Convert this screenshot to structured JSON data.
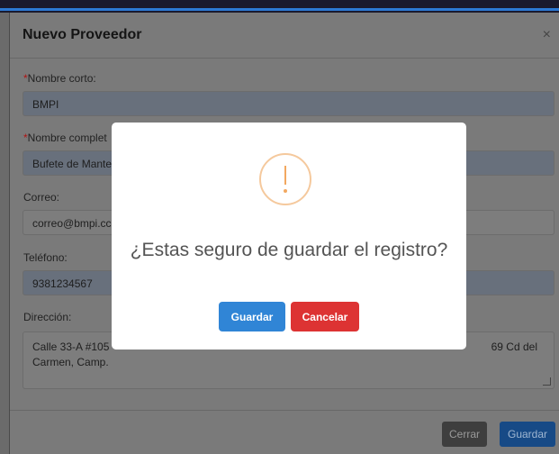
{
  "modal": {
    "title": "Nuevo Proveedor",
    "close_symbol": "×",
    "required_mark": "*",
    "fields": {
      "nombre_corto": {
        "label": "Nombre corto:",
        "value": "BMPI"
      },
      "nombre_completo": {
        "label": "Nombre complet",
        "value": "Bufete de Mante"
      },
      "correo": {
        "label": "Correo:",
        "value": "correo@bmpi.cc"
      },
      "telefono": {
        "label": "Teléfono:",
        "value": "9381234567"
      },
      "direccion": {
        "label": "Dirección:",
        "value_start": "Calle 33-A #105",
        "value_end": "69 Cd del",
        "value_line2": "Carmen, Camp."
      }
    },
    "footer": {
      "close_label": "Cerrar",
      "save_label": "Guardar"
    }
  },
  "dialog": {
    "icon": "warning-icon",
    "message": "¿Estas seguro de guardar el registro?",
    "confirm_label": "Guardar",
    "cancel_label": "Cancelar",
    "confirm_color": "#3085d6",
    "cancel_color": "#dd3333"
  }
}
